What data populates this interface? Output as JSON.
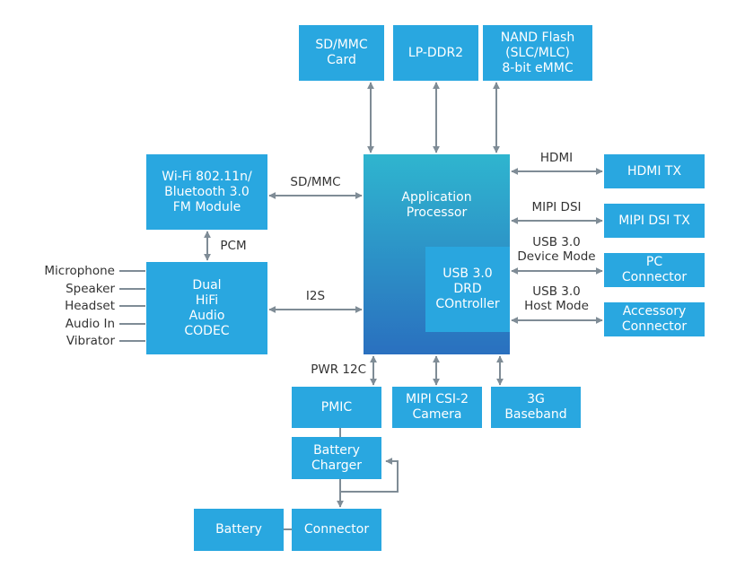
{
  "colors": {
    "box": "#29a7e0",
    "processor_top": "#2fb5cf",
    "processor_bottom": "#2a70bf",
    "connector_line": "#7f8c96"
  },
  "blocks": {
    "sd_card": "SD/MMC\nCard",
    "lpddr2": "LP-DDR2",
    "nand": "NAND Flash\n(SLC/MLC)\n8-bit eMMC",
    "processor": "Application\nProcessor",
    "usb_drd": "USB 3.0\nDRD\nCOntroller",
    "hdmi_tx": "HDMI TX",
    "mipi_dsi_tx": "MIPI DSI TX",
    "pc_connector": "PC\nConnector",
    "accessory_connector": "Accessory\nConnector",
    "wifi": "Wi-Fi 802.11n/\nBluetooth 3.0\nFM Module",
    "codec": "Dual\nHiFi\nAudio\nCODEC",
    "pmic": "PMIC",
    "camera": "MIPI CSI-2\nCamera",
    "baseband": "3G\nBaseband",
    "charger": "Battery\nCharger",
    "battery": "Battery",
    "connector": "Connector"
  },
  "links": {
    "hdmi": "HDMI",
    "mipi_dsi": "MIPI DSI",
    "usb_device": "USB 3.0\nDevice Mode",
    "usb_host": "USB 3.0\nHost Mode",
    "sdmmc": "SD/MMC",
    "pcm": "PCM",
    "i2s": "I2S",
    "pwr": "PWR 12C"
  },
  "audio_io": [
    "Microphone",
    "Speaker",
    "Headset",
    "Audio In",
    "Vibrator"
  ]
}
